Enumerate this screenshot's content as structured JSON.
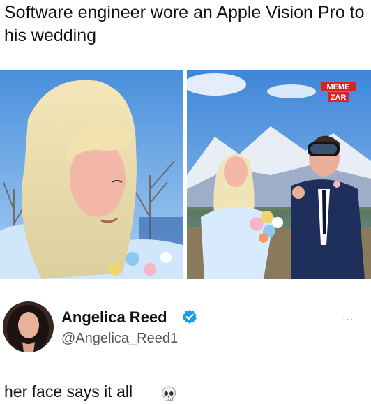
{
  "meme": {
    "caption": "Software engineer wore an Apple Vision Pro to his wedding",
    "watermark": {
      "line1": "MEME",
      "line2": "ZAR"
    }
  },
  "tweet": {
    "display_name": "Angelica Reed",
    "handle": "@Angelica_Reed1",
    "more_label": "...",
    "text": "her face says it all",
    "emoji_icon": "skull-icon",
    "verified_icon": "verified-badge-icon"
  },
  "colors": {
    "sky": "#5b9fe0",
    "verified_blue": "#1d9bf0",
    "watermark_red": "#d8232a",
    "suit_navy": "#1f2f5c",
    "dress_blue": "#cfe6fb"
  }
}
